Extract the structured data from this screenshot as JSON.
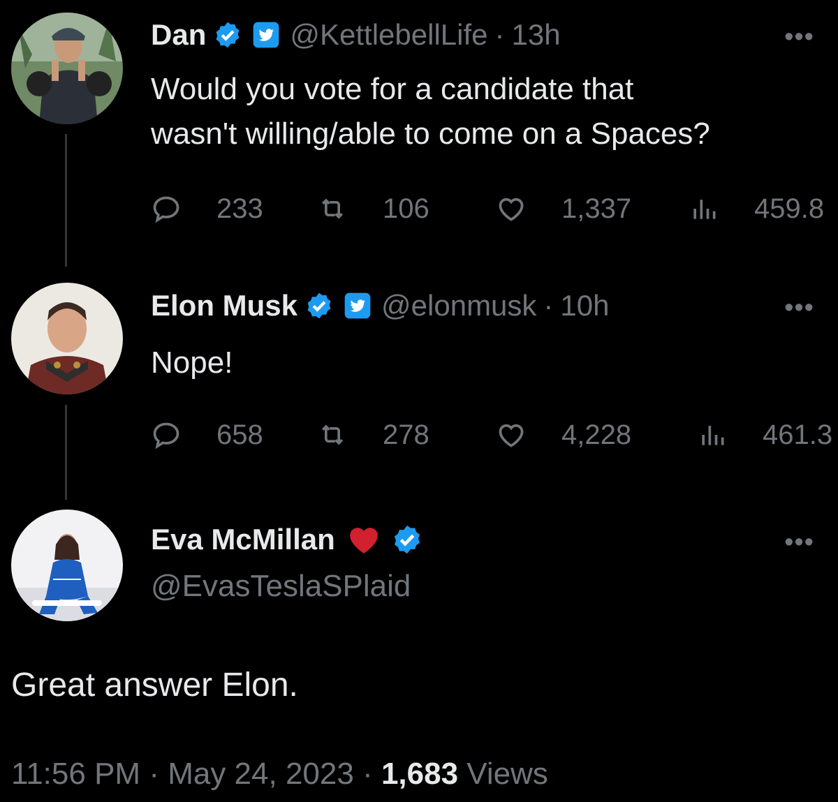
{
  "tweets": [
    {
      "name": "Dan",
      "handle": "@KettlebellLife",
      "dot": "·",
      "time": "13h",
      "text_lines": [
        "Would you vote for a candidate that",
        "wasn't willing/able to come on a Spaces?"
      ],
      "replies": "233",
      "retweets": "106",
      "likes": "1,337",
      "views": "459.8"
    },
    {
      "name": "Elon Musk",
      "handle": "@elonmusk",
      "dot": "·",
      "time": "10h",
      "text_lines": [
        "Nope!"
      ],
      "replies": "658",
      "retweets": "278",
      "likes": "4,228",
      "views": "461.3"
    }
  ],
  "main": {
    "name": "Eva McMillan",
    "handle": "@EvasTeslaSPlaid",
    "text": "Great answer Elon.",
    "time": "11:56 PM",
    "dot": "·",
    "date": "May 24, 2023",
    "views_count": "1,683",
    "views_label": "Views"
  },
  "more_label": "•••",
  "colors": {
    "background": "#000000",
    "text": "#e7e9ea",
    "muted": "#71767b",
    "verified_blue": "#1d9bf0",
    "heart_red": "#d1202e"
  },
  "icons": [
    "verified-badge-icon",
    "twitter-square-icon",
    "reply-icon",
    "retweet-icon",
    "like-icon",
    "views-icon",
    "more-icon",
    "heart-emoji-icon"
  ]
}
